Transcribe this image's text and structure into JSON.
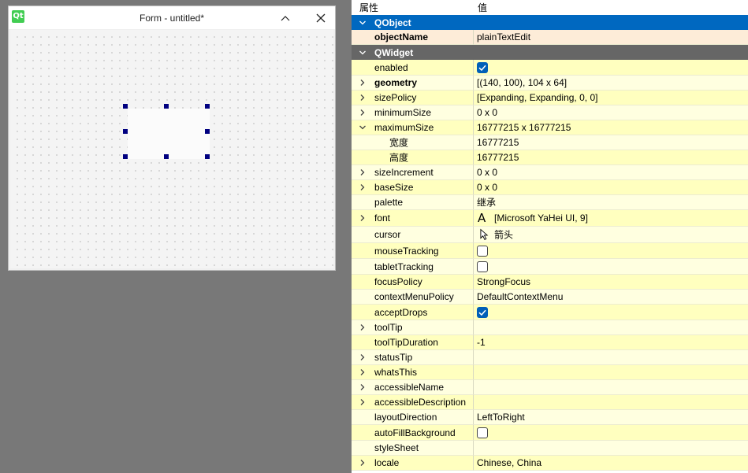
{
  "form_window": {
    "title": "Form - untitled*",
    "logo_text": "Qt"
  },
  "property_editor": {
    "header": {
      "property": "属性",
      "value": "值"
    },
    "rows": [
      {
        "kind": "group",
        "label": "QObject",
        "color": "#0068c0"
      },
      {
        "kind": "prop",
        "label": "objectName",
        "value": "plainTextEdit",
        "bold": true,
        "style": "obj"
      },
      {
        "kind": "group",
        "label": "QWidget",
        "color": "#666666"
      },
      {
        "kind": "prop",
        "label": "enabled",
        "checkbox": true,
        "checked": true
      },
      {
        "kind": "prop",
        "label": "geometry",
        "value": "[(140, 100), 104 x 64]",
        "expand": "collapsed",
        "bold": true
      },
      {
        "kind": "prop",
        "label": "sizePolicy",
        "value": "[Expanding, Expanding, 0, 0]",
        "expand": "collapsed"
      },
      {
        "kind": "prop",
        "label": "minimumSize",
        "value": "0 x 0",
        "expand": "collapsed"
      },
      {
        "kind": "prop",
        "label": "maximumSize",
        "value": "16777215 x 16777215",
        "expand": "expanded"
      },
      {
        "kind": "prop",
        "label": "宽度",
        "value": "16777215",
        "sub": true
      },
      {
        "kind": "prop",
        "label": "高度",
        "value": "16777215",
        "sub": true
      },
      {
        "kind": "prop",
        "label": "sizeIncrement",
        "value": "0 x 0",
        "expand": "collapsed"
      },
      {
        "kind": "prop",
        "label": "baseSize",
        "value": "0 x 0",
        "expand": "collapsed"
      },
      {
        "kind": "prop",
        "label": "palette",
        "value": "继承"
      },
      {
        "kind": "prop",
        "label": "font",
        "value": "[Microsoft YaHei UI, 9]",
        "expand": "collapsed",
        "icon": "font-icon"
      },
      {
        "kind": "prop",
        "label": "cursor",
        "value": "箭头",
        "icon": "arrow-cursor-icon"
      },
      {
        "kind": "prop",
        "label": "mouseTracking",
        "checkbox": true,
        "checked": false
      },
      {
        "kind": "prop",
        "label": "tabletTracking",
        "checkbox": true,
        "checked": false
      },
      {
        "kind": "prop",
        "label": "focusPolicy",
        "value": "StrongFocus"
      },
      {
        "kind": "prop",
        "label": "contextMenuPolicy",
        "value": "DefaultContextMenu"
      },
      {
        "kind": "prop",
        "label": "acceptDrops",
        "checkbox": true,
        "checked": true
      },
      {
        "kind": "prop",
        "label": "toolTip",
        "value": "",
        "expand": "collapsed"
      },
      {
        "kind": "prop",
        "label": "toolTipDuration",
        "value": "-1"
      },
      {
        "kind": "prop",
        "label": "statusTip",
        "value": "",
        "expand": "collapsed"
      },
      {
        "kind": "prop",
        "label": "whatsThis",
        "value": "",
        "expand": "collapsed"
      },
      {
        "kind": "prop",
        "label": "accessibleName",
        "value": "",
        "expand": "collapsed"
      },
      {
        "kind": "prop",
        "label": "accessibleDescription",
        "value": "",
        "expand": "collapsed"
      },
      {
        "kind": "prop",
        "label": "layoutDirection",
        "value": "LeftToRight"
      },
      {
        "kind": "prop",
        "label": "autoFillBackground",
        "checkbox": true,
        "checked": false
      },
      {
        "kind": "prop",
        "label": "styleSheet",
        "value": ""
      },
      {
        "kind": "prop",
        "label": "locale",
        "value": "Chinese, China",
        "expand": "collapsed"
      }
    ]
  }
}
